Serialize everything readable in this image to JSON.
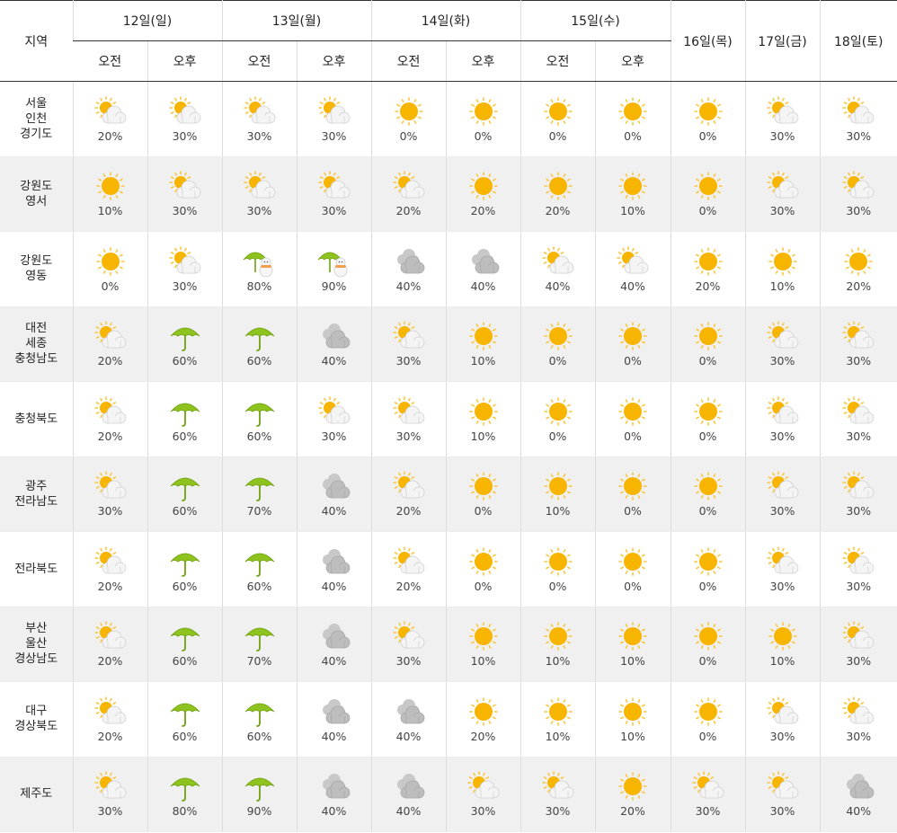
{
  "header": {
    "region_label": "지역",
    "days_split": [
      {
        "label": "12일(일)",
        "am": "오전",
        "pm": "오후"
      },
      {
        "label": "13일(월)",
        "am": "오전",
        "pm": "오후"
      },
      {
        "label": "14일(화)",
        "am": "오전",
        "pm": "오후"
      },
      {
        "label": "15일(수)",
        "am": "오전",
        "pm": "오후"
      }
    ],
    "days_single": [
      "16일(목)",
      "17일(금)",
      "18일(토)"
    ]
  },
  "rows": [
    {
      "region": [
        "서울",
        "인천",
        "경기도"
      ],
      "cells": [
        {
          "icon": "sun-cloud-icon",
          "pct": "20%"
        },
        {
          "icon": "sun-cloud-icon",
          "pct": "30%"
        },
        {
          "icon": "sun-cloud-icon",
          "pct": "30%"
        },
        {
          "icon": "sun-cloud-icon",
          "pct": "30%"
        },
        {
          "icon": "sun-icon",
          "pct": "0%"
        },
        {
          "icon": "sun-icon",
          "pct": "0%"
        },
        {
          "icon": "sun-icon",
          "pct": "0%"
        },
        {
          "icon": "sun-icon",
          "pct": "0%"
        },
        {
          "icon": "sun-icon",
          "pct": "0%"
        },
        {
          "icon": "sun-cloud-icon",
          "pct": "30%"
        },
        {
          "icon": "sun-cloud-icon",
          "pct": "30%"
        }
      ]
    },
    {
      "region": [
        "강원도",
        "영서"
      ],
      "cells": [
        {
          "icon": "sun-icon",
          "pct": "10%"
        },
        {
          "icon": "sun-cloud-icon",
          "pct": "30%"
        },
        {
          "icon": "sun-cloud-icon",
          "pct": "30%"
        },
        {
          "icon": "sun-cloud-icon",
          "pct": "30%"
        },
        {
          "icon": "sun-cloud-icon",
          "pct": "20%"
        },
        {
          "icon": "sun-icon",
          "pct": "20%"
        },
        {
          "icon": "sun-icon",
          "pct": "20%"
        },
        {
          "icon": "sun-icon",
          "pct": "10%"
        },
        {
          "icon": "sun-icon",
          "pct": "0%"
        },
        {
          "icon": "sun-cloud-icon",
          "pct": "30%"
        },
        {
          "icon": "sun-cloud-icon",
          "pct": "30%"
        }
      ]
    },
    {
      "region": [
        "강원도",
        "영동"
      ],
      "cells": [
        {
          "icon": "sun-icon",
          "pct": "0%"
        },
        {
          "icon": "sun-cloud-icon",
          "pct": "30%"
        },
        {
          "icon": "umbrella-snowman-icon",
          "pct": "80%"
        },
        {
          "icon": "umbrella-snowman-icon",
          "pct": "90%"
        },
        {
          "icon": "cloud-icon",
          "pct": "40%"
        },
        {
          "icon": "cloud-icon",
          "pct": "40%"
        },
        {
          "icon": "sun-cloud-icon",
          "pct": "40%"
        },
        {
          "icon": "sun-cloud-icon",
          "pct": "40%"
        },
        {
          "icon": "sun-icon",
          "pct": "20%"
        },
        {
          "icon": "sun-icon",
          "pct": "10%"
        },
        {
          "icon": "sun-icon",
          "pct": "20%"
        }
      ]
    },
    {
      "region": [
        "대전",
        "세종",
        "충청남도"
      ],
      "cells": [
        {
          "icon": "sun-cloud-icon",
          "pct": "20%"
        },
        {
          "icon": "umbrella-icon",
          "pct": "60%"
        },
        {
          "icon": "umbrella-icon",
          "pct": "60%"
        },
        {
          "icon": "cloud-icon",
          "pct": "40%"
        },
        {
          "icon": "sun-cloud-icon",
          "pct": "30%"
        },
        {
          "icon": "sun-icon",
          "pct": "10%"
        },
        {
          "icon": "sun-icon",
          "pct": "0%"
        },
        {
          "icon": "sun-icon",
          "pct": "0%"
        },
        {
          "icon": "sun-icon",
          "pct": "0%"
        },
        {
          "icon": "sun-cloud-icon",
          "pct": "30%"
        },
        {
          "icon": "sun-cloud-icon",
          "pct": "30%"
        }
      ]
    },
    {
      "region": [
        "충청북도"
      ],
      "cells": [
        {
          "icon": "sun-cloud-icon",
          "pct": "20%"
        },
        {
          "icon": "umbrella-icon",
          "pct": "60%"
        },
        {
          "icon": "umbrella-icon",
          "pct": "60%"
        },
        {
          "icon": "sun-cloud-icon",
          "pct": "30%"
        },
        {
          "icon": "sun-cloud-icon",
          "pct": "30%"
        },
        {
          "icon": "sun-icon",
          "pct": "10%"
        },
        {
          "icon": "sun-icon",
          "pct": "0%"
        },
        {
          "icon": "sun-icon",
          "pct": "0%"
        },
        {
          "icon": "sun-icon",
          "pct": "0%"
        },
        {
          "icon": "sun-cloud-icon",
          "pct": "30%"
        },
        {
          "icon": "sun-cloud-icon",
          "pct": "30%"
        }
      ]
    },
    {
      "region": [
        "광주",
        "전라남도"
      ],
      "cells": [
        {
          "icon": "sun-cloud-icon",
          "pct": "30%"
        },
        {
          "icon": "umbrella-icon",
          "pct": "60%"
        },
        {
          "icon": "umbrella-icon",
          "pct": "70%"
        },
        {
          "icon": "cloud-icon",
          "pct": "40%"
        },
        {
          "icon": "sun-cloud-icon",
          "pct": "20%"
        },
        {
          "icon": "sun-icon",
          "pct": "0%"
        },
        {
          "icon": "sun-icon",
          "pct": "10%"
        },
        {
          "icon": "sun-icon",
          "pct": "0%"
        },
        {
          "icon": "sun-icon",
          "pct": "0%"
        },
        {
          "icon": "sun-cloud-icon",
          "pct": "30%"
        },
        {
          "icon": "sun-cloud-icon",
          "pct": "30%"
        }
      ]
    },
    {
      "region": [
        "전라북도"
      ],
      "cells": [
        {
          "icon": "sun-cloud-icon",
          "pct": "20%"
        },
        {
          "icon": "umbrella-icon",
          "pct": "60%"
        },
        {
          "icon": "umbrella-icon",
          "pct": "60%"
        },
        {
          "icon": "cloud-icon",
          "pct": "40%"
        },
        {
          "icon": "sun-cloud-icon",
          "pct": "20%"
        },
        {
          "icon": "sun-icon",
          "pct": "0%"
        },
        {
          "icon": "sun-icon",
          "pct": "0%"
        },
        {
          "icon": "sun-icon",
          "pct": "0%"
        },
        {
          "icon": "sun-icon",
          "pct": "0%"
        },
        {
          "icon": "sun-cloud-icon",
          "pct": "30%"
        },
        {
          "icon": "sun-cloud-icon",
          "pct": "30%"
        }
      ]
    },
    {
      "region": [
        "부산",
        "울산",
        "경상남도"
      ],
      "cells": [
        {
          "icon": "sun-cloud-icon",
          "pct": "20%"
        },
        {
          "icon": "umbrella-icon",
          "pct": "60%"
        },
        {
          "icon": "umbrella-icon",
          "pct": "70%"
        },
        {
          "icon": "cloud-icon",
          "pct": "40%"
        },
        {
          "icon": "sun-cloud-icon",
          "pct": "30%"
        },
        {
          "icon": "sun-icon",
          "pct": "10%"
        },
        {
          "icon": "sun-icon",
          "pct": "10%"
        },
        {
          "icon": "sun-icon",
          "pct": "10%"
        },
        {
          "icon": "sun-icon",
          "pct": "0%"
        },
        {
          "icon": "sun-icon",
          "pct": "10%"
        },
        {
          "icon": "sun-cloud-icon",
          "pct": "30%"
        }
      ]
    },
    {
      "region": [
        "대구",
        "경상북도"
      ],
      "cells": [
        {
          "icon": "sun-cloud-icon",
          "pct": "20%"
        },
        {
          "icon": "umbrella-icon",
          "pct": "60%"
        },
        {
          "icon": "umbrella-icon",
          "pct": "60%"
        },
        {
          "icon": "cloud-icon",
          "pct": "40%"
        },
        {
          "icon": "cloud-icon",
          "pct": "40%"
        },
        {
          "icon": "sun-icon",
          "pct": "20%"
        },
        {
          "icon": "sun-icon",
          "pct": "10%"
        },
        {
          "icon": "sun-icon",
          "pct": "10%"
        },
        {
          "icon": "sun-icon",
          "pct": "0%"
        },
        {
          "icon": "sun-cloud-icon",
          "pct": "30%"
        },
        {
          "icon": "sun-cloud-icon",
          "pct": "30%"
        }
      ]
    },
    {
      "region": [
        "제주도"
      ],
      "cells": [
        {
          "icon": "sun-cloud-icon",
          "pct": "30%"
        },
        {
          "icon": "umbrella-icon",
          "pct": "80%"
        },
        {
          "icon": "umbrella-icon",
          "pct": "90%"
        },
        {
          "icon": "cloud-icon",
          "pct": "40%"
        },
        {
          "icon": "cloud-icon",
          "pct": "40%"
        },
        {
          "icon": "sun-cloud-icon",
          "pct": "30%"
        },
        {
          "icon": "sun-cloud-icon",
          "pct": "30%"
        },
        {
          "icon": "sun-icon",
          "pct": "20%"
        },
        {
          "icon": "sun-cloud-icon",
          "pct": "30%"
        },
        {
          "icon": "sun-cloud-icon",
          "pct": "30%"
        },
        {
          "icon": "cloud-icon",
          "pct": "40%"
        }
      ]
    }
  ],
  "colors": {
    "sun": "#f7b500",
    "sun_ray": "#f9c640",
    "cloud": "#eeeeee",
    "cloud_dark": "#b5b5b5",
    "umbrella": "#8dc21f",
    "row_alt_bg": "#f0f0f0"
  }
}
